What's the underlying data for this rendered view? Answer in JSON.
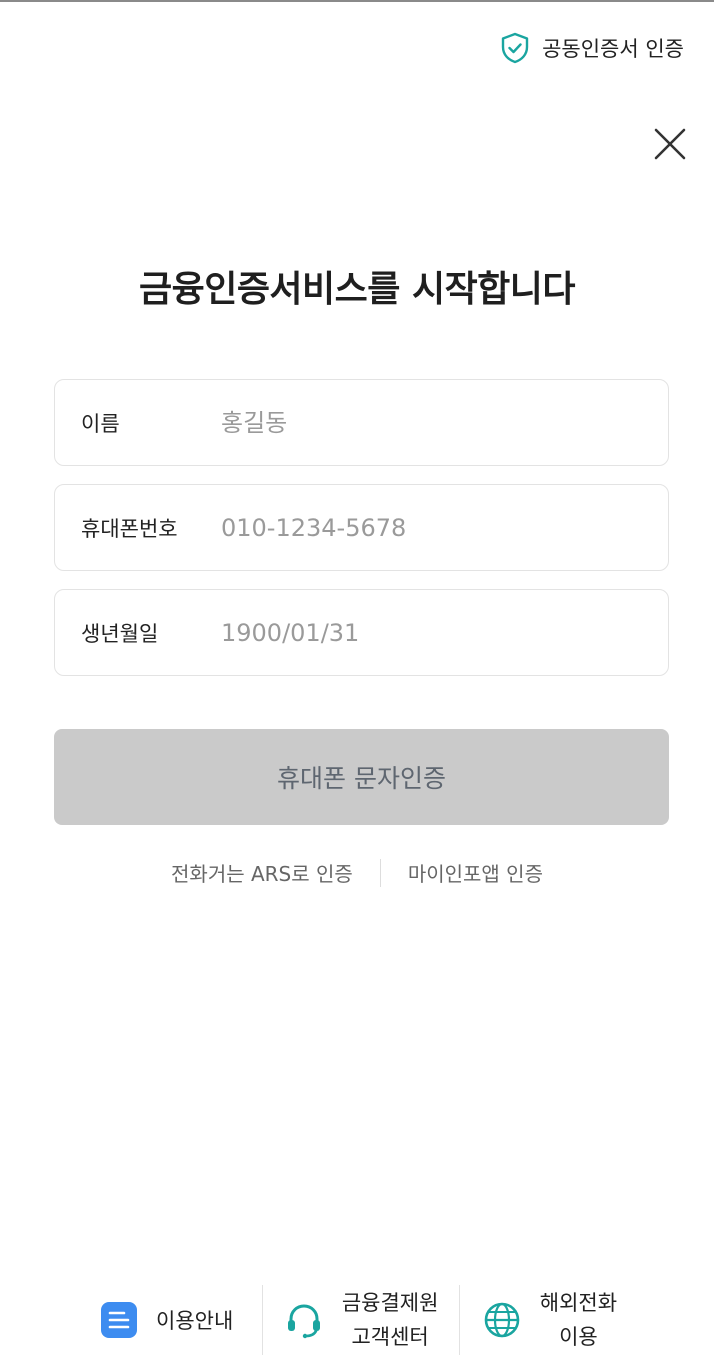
{
  "header": {
    "cert_label": "공동인증서 인증",
    "cert_icon": "shield-check-icon",
    "close_icon": "close-icon"
  },
  "title": "금융인증서비스를 시작합니다",
  "form": {
    "name": {
      "label": "이름",
      "placeholder": "홍길동",
      "value": ""
    },
    "phone": {
      "label": "휴대폰번호",
      "placeholder": "010-1234-5678",
      "value": ""
    },
    "birth": {
      "label": "생년월일",
      "placeholder": "1900/01/31",
      "value": ""
    }
  },
  "primary_button": "휴대폰 문자인증",
  "alt_links": {
    "ars": "전화거는 ARS로 인증",
    "mypin": "마이인포앱 인증"
  },
  "bottom": {
    "guide": {
      "label": "이용안내",
      "icon": "document-icon"
    },
    "support": {
      "line1": "금융결제원",
      "line2": "고객센터",
      "icon": "headset-icon"
    },
    "overseas": {
      "line1": "해외전화",
      "line2": "이용",
      "icon": "globe-icon"
    }
  },
  "colors": {
    "accent_teal": "#1aa5a0",
    "button_disabled": "#cacaca",
    "doc_icon_blue": "#3d8cf0"
  }
}
